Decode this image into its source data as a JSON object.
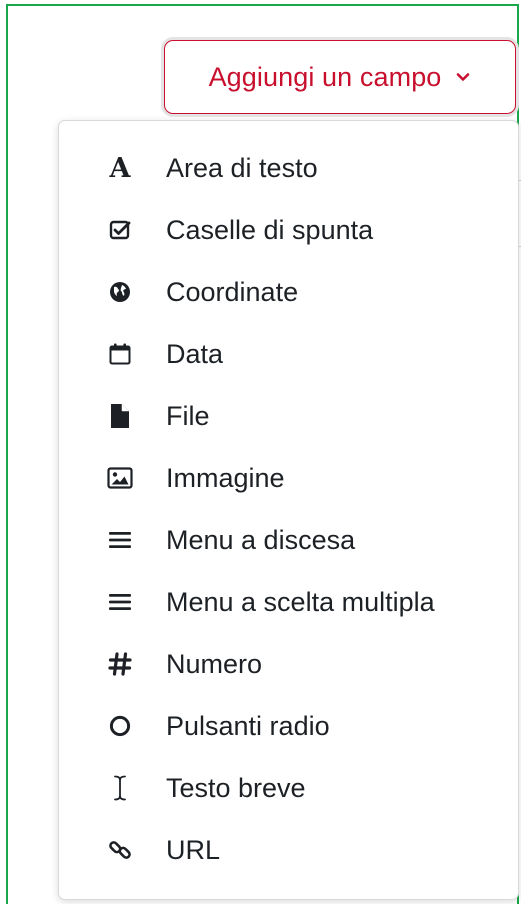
{
  "button": {
    "label": "Aggiungi un campo",
    "color": "#c8102e"
  },
  "menu": {
    "items": [
      {
        "label": "Area di testo",
        "icon": "text-area-icon"
      },
      {
        "label": "Caselle di spunta",
        "icon": "checkbox-icon"
      },
      {
        "label": "Coordinate",
        "icon": "globe-icon"
      },
      {
        "label": "Data",
        "icon": "calendar-icon"
      },
      {
        "label": "File",
        "icon": "file-icon"
      },
      {
        "label": "Immagine",
        "icon": "image-icon"
      },
      {
        "label": "Menu a discesa",
        "icon": "bars-icon"
      },
      {
        "label": "Menu a scelta multipla",
        "icon": "bars-icon"
      },
      {
        "label": "Numero",
        "icon": "hashtag-icon"
      },
      {
        "label": "Pulsanti radio",
        "icon": "radio-circle-icon"
      },
      {
        "label": "Testo breve",
        "icon": "text-cursor-icon"
      },
      {
        "label": "URL",
        "icon": "link-icon"
      }
    ]
  },
  "colors": {
    "frame": "#1aa64b",
    "text": "#1d2125",
    "icon": "#1d2125"
  }
}
